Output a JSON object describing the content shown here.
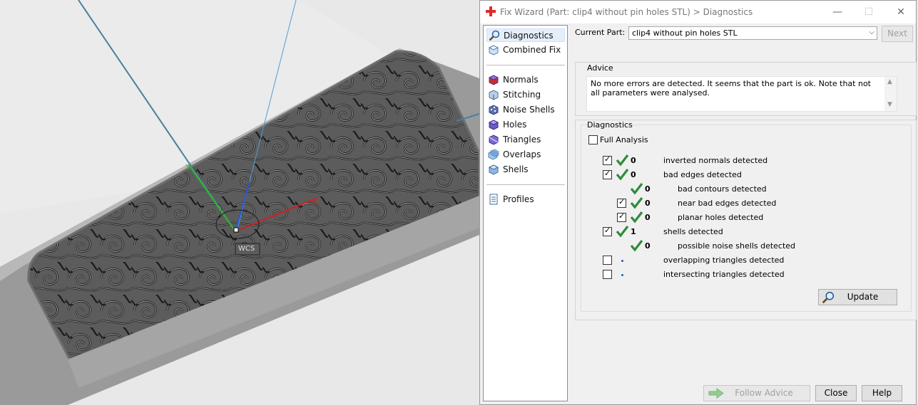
{
  "viewport": {
    "marker_label": "WCS"
  },
  "dialog": {
    "title": "Fix Wizard (Part: clip4 without pin holes STL) > Diagnostics",
    "window_buttons": {
      "minimize": "—",
      "maximize": "☐",
      "close": "✕"
    },
    "nav": {
      "items": [
        {
          "label": "Diagnostics",
          "icon": "magnifier-icon",
          "selected": true
        },
        {
          "label": "Combined Fix",
          "icon": "cube-fix-icon"
        },
        {
          "label": "Normals",
          "icon": "normals-cube-icon"
        },
        {
          "label": "Stitching",
          "icon": "stitching-cube-icon"
        },
        {
          "label": "Noise Shells",
          "icon": "noise-shells-icon"
        },
        {
          "label": "Holes",
          "icon": "holes-cube-icon"
        },
        {
          "label": "Triangles",
          "icon": "triangles-cube-icon"
        },
        {
          "label": "Overlaps",
          "icon": "overlaps-icon"
        },
        {
          "label": "Shells",
          "icon": "shells-cube-icon"
        },
        {
          "label": "Profiles",
          "icon": "document-icon"
        }
      ]
    },
    "current_part": {
      "label": "Current Part:",
      "value": "clip4 without pin holes STL"
    },
    "next_button": "Next",
    "advice": {
      "title": "Advice",
      "text": "No more errors are detected. It seems that the part is ok. Note that not all parameters were analysed."
    },
    "diagnostics": {
      "title": "Diagnostics",
      "full_analysis_label": "Full Analysis",
      "rows": [
        {
          "count": "0",
          "label": "inverted normals detected"
        },
        {
          "count": "0",
          "label": "bad edges detected"
        },
        {
          "count": "0",
          "label": "bad contours detected"
        },
        {
          "count": "0",
          "label": "near bad edges detected"
        },
        {
          "count": "0",
          "label": "planar holes detected"
        },
        {
          "count": "1",
          "label": "shells detected"
        },
        {
          "count": "0",
          "label": "possible noise shells detected"
        },
        {
          "count": "",
          "label": "overlapping triangles detected"
        },
        {
          "count": "",
          "label": "intersecting triangles detected"
        }
      ],
      "update_button": "Update"
    },
    "footer": {
      "follow_advice": "Follow Advice",
      "close": "Close",
      "help": "Help"
    },
    "colors": {
      "accent_check": "#2f8c3a",
      "disabled_arrow": "#8fcf8f"
    }
  }
}
